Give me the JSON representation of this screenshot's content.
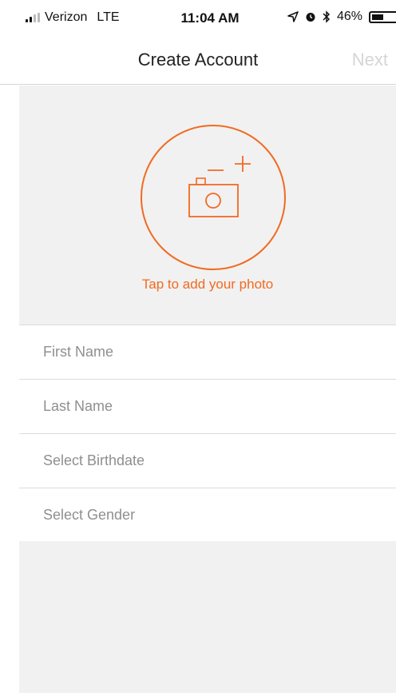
{
  "status_bar": {
    "carrier": "Verizon",
    "network": "LTE",
    "time": "11:04 AM",
    "battery": "46%",
    "battery_level": 0.46,
    "signal_bars": 2,
    "icons": [
      "location-arrow-icon",
      "alarm-icon",
      "bluetooth-icon",
      "battery-icon"
    ]
  },
  "nav": {
    "title": "Create Account",
    "next_label": "Next"
  },
  "photo": {
    "hint": "Tap to add your photo",
    "icon": "camera-add-icon"
  },
  "form": {
    "first_name": {
      "placeholder": "First Name",
      "value": ""
    },
    "last_name": {
      "placeholder": "Last Name",
      "value": ""
    },
    "birthdate": {
      "placeholder": "Select Birthdate"
    },
    "gender": {
      "placeholder": "Select Gender"
    }
  },
  "colors": {
    "accent": "#f26a21",
    "disabled_text": "#d5d5d5",
    "placeholder_text": "#8f8f8f",
    "panel_background": "#f1f1f1"
  }
}
